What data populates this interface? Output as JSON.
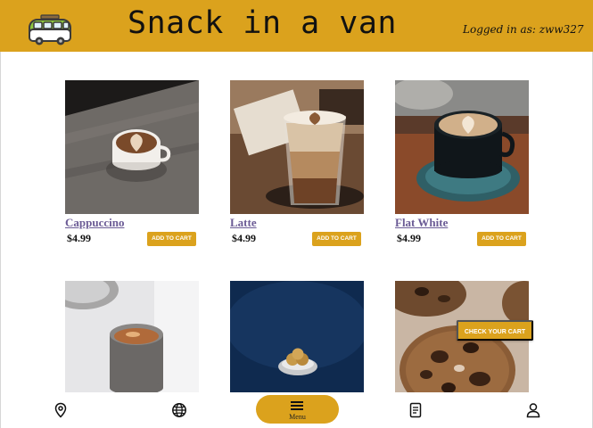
{
  "header": {
    "title": "Snack in a van",
    "user_label": "Logged in as: zww327"
  },
  "products": [
    {
      "name": "Cappuccino",
      "price": "$4.99",
      "add_label": "ADD TO CART"
    },
    {
      "name": "Latte",
      "price": "$4.99",
      "add_label": "ADD TO CART"
    },
    {
      "name": "Flat White",
      "price": "$4.99",
      "add_label": "ADD TO CART"
    },
    {
      "name": "",
      "price": "",
      "add_label": ""
    },
    {
      "name": "",
      "price": "",
      "add_label": ""
    },
    {
      "name": "",
      "price": "",
      "add_label": ""
    }
  ],
  "checkout_label": "CHECK YOUR CART",
  "bottom_nav": {
    "menu_label": "Menu",
    "icons": [
      "location-pin-icon",
      "globe-icon",
      "menu-icon",
      "receipt-icon",
      "user-icon"
    ]
  },
  "colors": {
    "brand": "#dba21d",
    "link": "#6b5b95"
  }
}
